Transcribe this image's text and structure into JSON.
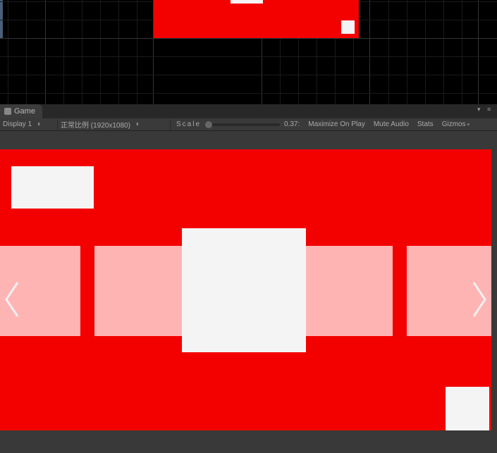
{
  "tab": {
    "label": "Game"
  },
  "toolbar": {
    "display": "Display 1",
    "aspect": "正常比例 (1920x1080)",
    "scale_label": "Scale",
    "scale_value": "0.37:",
    "maximize": "Maximize On Play",
    "mute": "Mute Audio",
    "stats": "Stats",
    "gizmos": "Gizmos"
  }
}
